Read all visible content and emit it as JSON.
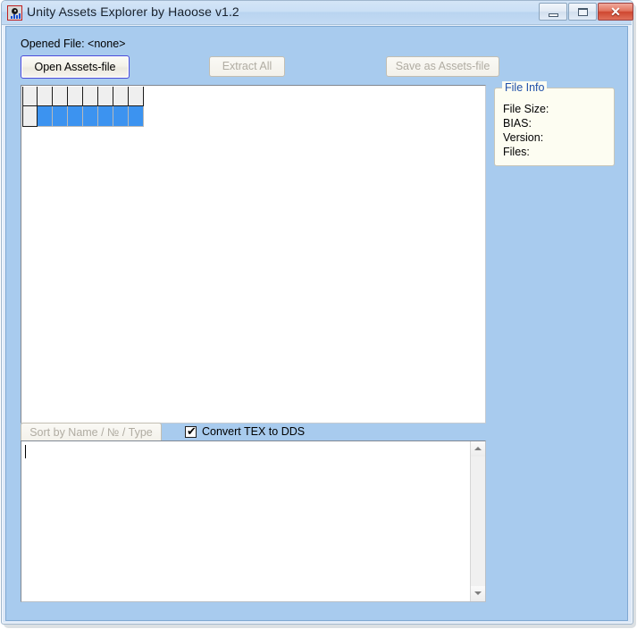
{
  "window": {
    "title": "Unity Assets Explorer by Haoose v1.2",
    "icon": "app-icon",
    "controls": {
      "minimize": "minimize-icon",
      "maximize": "maximize-icon",
      "close_label": "✕"
    }
  },
  "toolbar": {
    "opened_file_label": "Opened File: <none>",
    "open_button": "Open Assets-file",
    "extract_button": "Extract All",
    "save_button": "Save as Assets-file"
  },
  "listview": {
    "header_cells": [
      "",
      "",
      "",
      "",
      "",
      "",
      "",
      ""
    ],
    "rows": [
      {
        "selected": true,
        "cells": [
          "",
          "",
          "",
          "",
          "",
          "",
          "",
          ""
        ]
      }
    ]
  },
  "file_info": {
    "legend": "File Info",
    "fields": [
      "File Size:",
      "BIAS:",
      "Version:",
      "Files:"
    ]
  },
  "bottom_bar": {
    "sort_button": "Sort by Name / № / Type",
    "convert_checkbox_label": "Convert TEX to DDS",
    "convert_checkbox_checked": true,
    "checkbox_tick": "✔"
  },
  "log": {
    "text": ""
  },
  "colors": {
    "client_background": "#a8cbee",
    "selection": "#3c93f0",
    "group_title": "#1f4fa8",
    "default_button_border": "#4a4ad8",
    "close_button": "#cf4730"
  }
}
